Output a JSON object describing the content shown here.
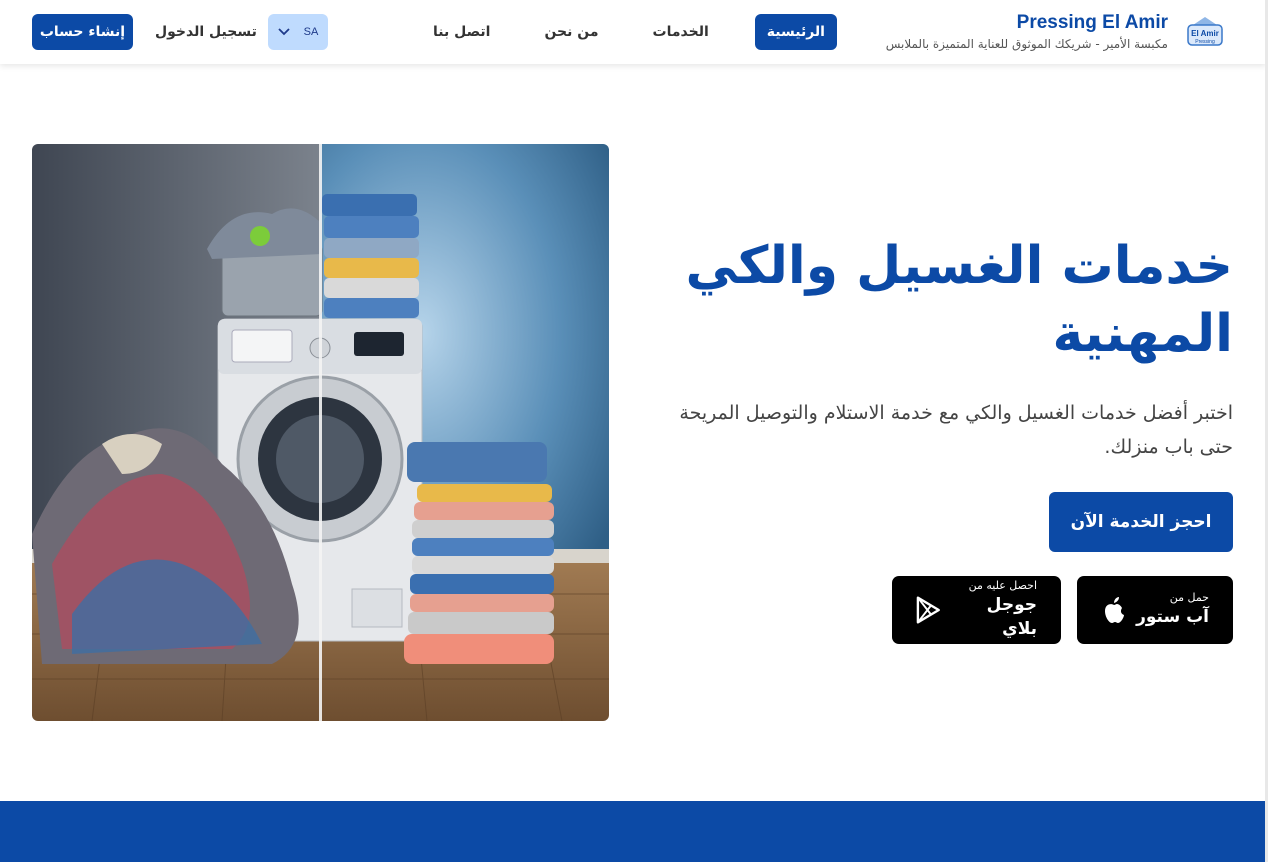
{
  "brand": {
    "name": "Pressing El Amir",
    "tagline": "مكبسة الأمير - شريكك الموثوق للعناية المتميزة بالملابس",
    "logo_text": "El Amir",
    "logo_subtext": "Pressing"
  },
  "nav": {
    "items": [
      {
        "label": "الرئيسية",
        "active": true
      },
      {
        "label": "الخدمات",
        "active": false
      },
      {
        "label": "من نحن",
        "active": false
      },
      {
        "label": "اتصل بنا",
        "active": false
      }
    ]
  },
  "header_actions": {
    "language_code": "SA",
    "login_label": "تسجيل الدخول",
    "signup_label": "إنشاء حساب"
  },
  "hero": {
    "title": "خدمات الغسيل والكي المهنية",
    "description": "اختبر أفضل خدمات الغسيل والكي مع خدمة الاستلام والتوصيل المريحة حتى باب منزلك.",
    "cta_label": "احجز الخدمة الآن"
  },
  "stores": {
    "apple": {
      "small": "حمل من",
      "big": "آب ستور"
    },
    "google": {
      "small": "احصل عليه من",
      "big": "جوجل بلاي"
    }
  },
  "colors": {
    "primary": "#0c4aa6",
    "language_bg": "#bfdbfe",
    "store_bg": "#000000"
  }
}
